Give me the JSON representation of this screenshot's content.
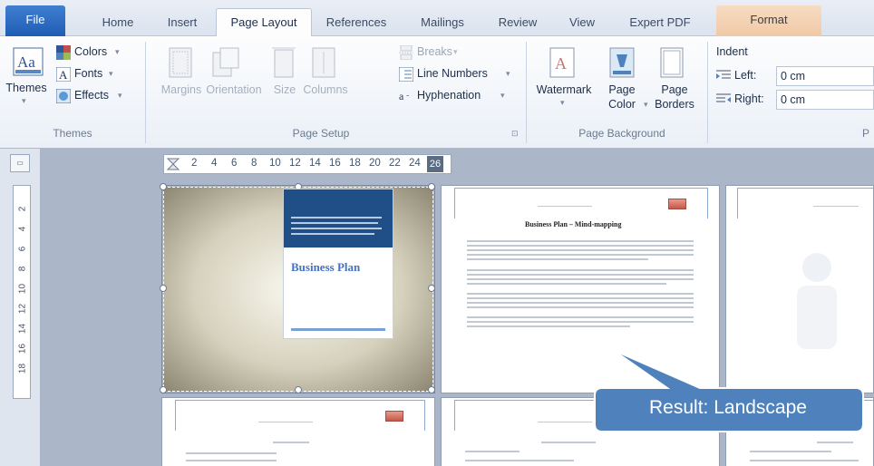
{
  "tabs": [
    {
      "label": "File"
    },
    {
      "label": "Home"
    },
    {
      "label": "Insert"
    },
    {
      "label": "Page Layout"
    },
    {
      "label": "References"
    },
    {
      "label": "Mailings"
    },
    {
      "label": "Review"
    },
    {
      "label": "View"
    },
    {
      "label": "Expert PDF"
    },
    {
      "label": "Format"
    }
  ],
  "ribbon": {
    "themes": {
      "themes_label": "Themes",
      "colors_label": "Colors",
      "fonts_label": "Fonts",
      "effects_label": "Effects",
      "group_label": "Themes"
    },
    "page_setup": {
      "margins_label": "Margins",
      "orientation_label": "Orientation",
      "size_label": "Size",
      "columns_label": "Columns",
      "breaks_label": "Breaks",
      "line_numbers_label": "Line Numbers",
      "hyphenation_label": "Hyphenation",
      "group_label": "Page Setup"
    },
    "page_background": {
      "watermark_label": "Watermark",
      "page_color_line1": "Page",
      "page_color_line2": "Color",
      "page_borders_line1": "Page",
      "page_borders_line2": "Borders",
      "group_label": "Page Background"
    },
    "paragraph": {
      "indent_label": "Indent",
      "left_label": "Left:",
      "left_value": "0 cm",
      "right_label": "Right:",
      "right_value": "0 cm",
      "group_label_partial": "P"
    }
  },
  "hruler": {
    "numbers": [
      "2",
      "4",
      "6",
      "8",
      "10",
      "12",
      "14",
      "16",
      "18",
      "20",
      "22",
      "24"
    ],
    "end_value": "26"
  },
  "vruler": {
    "numbers": [
      "2",
      "4",
      "6",
      "8",
      "10",
      "12",
      "14",
      "16",
      "18"
    ]
  },
  "cover": {
    "title": "Business Plan"
  },
  "page2": {
    "title": "Business Plan – Mind-mapping"
  },
  "callout": {
    "text": "Result: Landscape",
    "fill": "#4f81bd",
    "stroke": "#ffffff"
  },
  "colors": {
    "file_tab": "#2a66bf",
    "active_tab": "#fdfdfe",
    "format_tab": "#f3d2b3"
  }
}
